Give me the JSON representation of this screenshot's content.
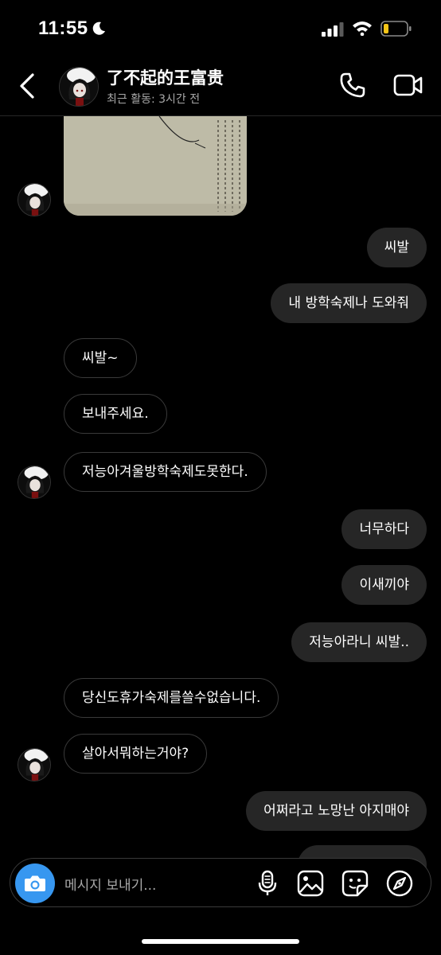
{
  "status": {
    "time": "11:55",
    "icons": [
      "moon-icon",
      "signal-icon",
      "wifi-icon",
      "battery-icon"
    ],
    "battery_color": "#f5c518"
  },
  "header": {
    "contact_name": "了不起的王富贵",
    "activity": "최근 활동: 3시간 전",
    "icons": [
      "back-chevron-icon",
      "phone-icon",
      "video-camera-icon"
    ]
  },
  "messages": [
    {
      "dir": "in",
      "text": "씨발~"
    },
    {
      "dir": "in",
      "text": "보내주세요."
    },
    {
      "dir": "in",
      "text": "저능아겨울방학숙제도못한다."
    },
    {
      "dir": "out",
      "text": "씨발"
    },
    {
      "dir": "out",
      "text": "내 방학숙제나 도와줘"
    },
    {
      "dir": "out",
      "text": "너무하다"
    },
    {
      "dir": "out",
      "text": "이새끼야"
    },
    {
      "dir": "out",
      "text": "저능아라니 씨발.."
    },
    {
      "dir": "in",
      "text": "당신도휴가숙제를쓸수없습니다."
    },
    {
      "dir": "in",
      "text": "살아서뭐하는거야?"
    },
    {
      "dir": "out",
      "text": "어쩌라고 노망난 아지매야"
    }
  ],
  "composer": {
    "placeholder": "메시지 보내기...",
    "icons": [
      "camera-icon",
      "microphone-icon",
      "gallery-icon",
      "sticker-icon",
      "compass-icon"
    ],
    "accent": "#3797f0"
  },
  "colors": {
    "background": "#000000",
    "outgoing_bubble": "#262626",
    "incoming_border": "#3a3a3a",
    "secondary_text": "#a8a8a8"
  }
}
